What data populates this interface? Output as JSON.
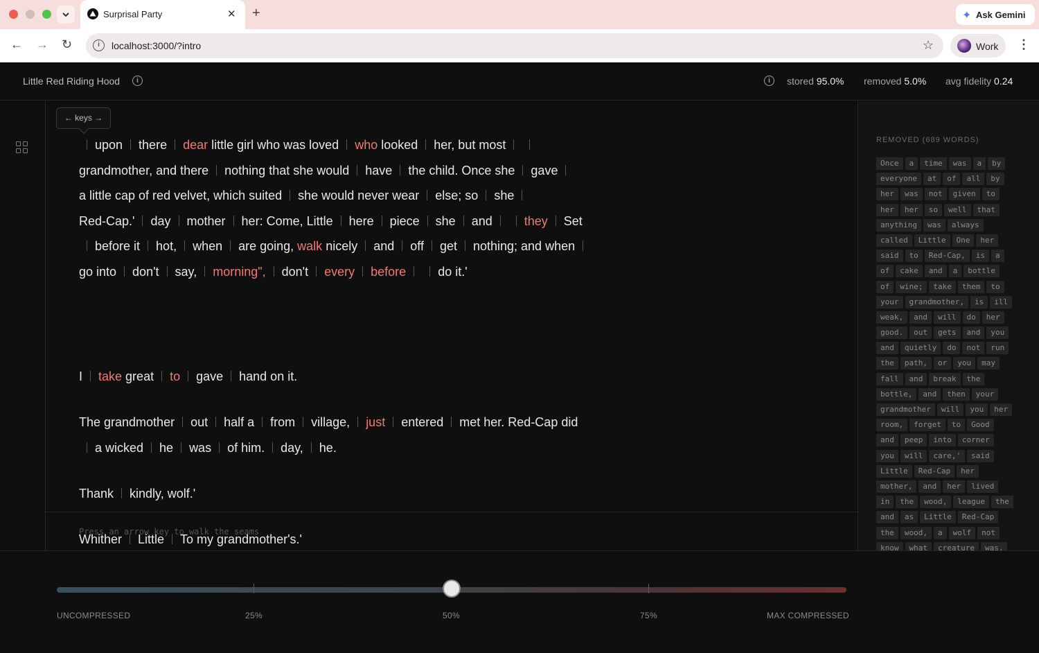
{
  "browser": {
    "tab_title": "Surprisal Party",
    "tab_close": "✕",
    "new_tab": "+",
    "gemini_label": "Ask Gemini",
    "url": "localhost:3000/?intro",
    "profile_label": "Work",
    "menu_dots": "⋮"
  },
  "header": {
    "doc_title": "Little Red Riding Hood",
    "stats": [
      {
        "label": "stored ",
        "value": "95.0%"
      },
      {
        "label": "removed ",
        "value": "5.0%"
      },
      {
        "label": "avg fidelity ",
        "value": "0.24"
      }
    ]
  },
  "keys_tooltip": "← keys →",
  "paragraphs": [
    [
      "",
      "upon",
      "there",
      "<dear> little girl who was loved",
      "<who> looked",
      "her, but most",
      "",
      "grandmother, and there",
      "nothing that she would",
      "have",
      "the child. Once she",
      "gave",
      "a little cap of red velvet, which suited",
      "she would never wear",
      "else; so",
      "she",
      "Red-Cap.'",
      "day",
      "mother",
      "her: Come, Little",
      "here",
      "piece",
      "she",
      "and",
      "",
      "<they>",
      "Set",
      "before it",
      "hot,",
      "when",
      "are going, <walk> nicely",
      "and",
      "off",
      "get",
      "nothing; and when",
      "go into",
      "don't",
      "say,",
      "<morning\",>",
      "don't",
      "<every>",
      "<before>",
      "",
      "do it.'"
    ],
    [
      "I",
      "<take> great",
      "<to>",
      "gave",
      "hand on it."
    ],
    [
      "The grandmother",
      "out",
      "half a",
      "from",
      "village,",
      "<just>",
      "entered",
      "met her. Red-Cap did",
      "a wicked",
      "he",
      "was",
      "of him.",
      "day,",
      "he."
    ],
    [
      "Thank",
      "kindly, wolf.'"
    ],
    [
      "Whither",
      "Little",
      "To my grandmother's.'"
    ]
  ],
  "hint": "Press an arrow key to walk the seams",
  "removed": {
    "title": "REMOVED (689 WORDS)",
    "rows": [
      [
        "Once",
        "a",
        "time",
        "was",
        "a",
        "by"
      ],
      [
        "everyone",
        "at",
        "of",
        "all",
        "by"
      ],
      [
        "her",
        "was",
        "not",
        "given",
        "to"
      ],
      [
        "her",
        "her",
        "so",
        "well",
        "that"
      ],
      [
        "anything",
        "was",
        "always"
      ],
      [
        "called",
        "Little",
        "One",
        "her"
      ],
      [
        "said",
        "to",
        "Red-Cap,",
        "is",
        "a"
      ],
      [
        "of",
        "cake",
        "and",
        "a",
        "bottle"
      ],
      [
        "of",
        "wine;",
        "take",
        "them",
        "to"
      ],
      [
        "your",
        "grandmother,",
        "is",
        "ill"
      ],
      [
        "weak,",
        "and",
        "will",
        "do",
        "her"
      ],
      [
        "good.",
        "out",
        "gets",
        "and",
        "you"
      ],
      [
        "and",
        "quietly",
        "do",
        "not",
        "run"
      ],
      [
        "the",
        "path,",
        "or",
        "you",
        "may"
      ],
      [
        "fall",
        "and",
        "break",
        "the"
      ],
      [
        "bottle,",
        "and",
        "then",
        "your"
      ],
      [
        "grandmother",
        "will",
        "you",
        "her"
      ],
      [
        "room,",
        "forget",
        "to",
        "Good"
      ],
      [
        "and",
        "peep",
        "into",
        "corner"
      ],
      [
        "you",
        "will",
        "care,'",
        "said"
      ],
      [
        "Little",
        "Red-Cap",
        "her"
      ],
      [
        "mother,",
        "and",
        "her",
        "lived"
      ],
      [
        "in",
        "the",
        "wood,",
        "league",
        "the"
      ],
      [
        "and",
        "as",
        "Little",
        "Red-Cap"
      ],
      [
        "the",
        "wood,",
        "a",
        "wolf",
        "not"
      ],
      [
        "know",
        "what",
        "creature",
        "was."
      ]
    ]
  },
  "slider": {
    "value_percent": 50,
    "labels": [
      "UNCOMPRESSED",
      "25%",
      "50%",
      "75%",
      "MAX COMPRESSED"
    ]
  }
}
